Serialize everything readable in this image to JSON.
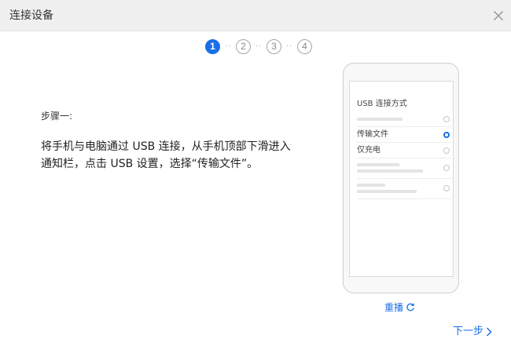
{
  "window": {
    "title": "连接设备"
  },
  "steps": {
    "items": [
      "1",
      "2",
      "3",
      "4"
    ],
    "current": 1,
    "separator": "··"
  },
  "content": {
    "step_label": "步骤一:",
    "description": "将手机与电脑通过 USB 连接，从手机顶部下滑进入通知栏，点击 USB 设置，选择“传输文件”。"
  },
  "phone": {
    "screen_title": "USB 连接方式",
    "options": [
      {
        "label": "",
        "selected": false
      },
      {
        "label": "传输文件",
        "selected": true
      },
      {
        "label": "仅充电",
        "selected": false
      },
      {
        "label": "",
        "selected": false
      },
      {
        "label": "",
        "selected": false
      }
    ]
  },
  "actions": {
    "replay_label": "重播",
    "next_label": "下一步"
  },
  "colors": {
    "accent": "#1a6fe8",
    "title_bar": "#f0f0f0"
  },
  "icons": {
    "close": "close-icon",
    "replay": "refresh-icon",
    "next": "chevron-right-icon"
  }
}
